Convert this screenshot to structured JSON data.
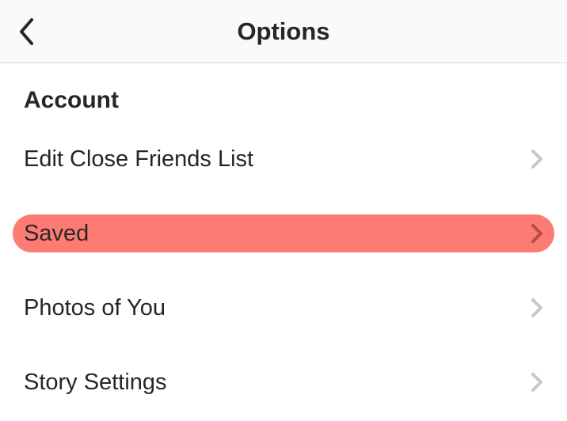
{
  "header": {
    "title": "Options"
  },
  "section": {
    "title": "Account"
  },
  "items": [
    {
      "label": "Edit Close Friends List",
      "highlighted": false
    },
    {
      "label": "Saved",
      "highlighted": true
    },
    {
      "label": "Photos of You",
      "highlighted": false
    },
    {
      "label": "Story Settings",
      "highlighted": false
    }
  ],
  "colors": {
    "highlight": "#fc7c74",
    "background": "#ffffff",
    "headerBg": "#fafafa",
    "text": "#262626",
    "chevron": "#c7c7cc"
  }
}
